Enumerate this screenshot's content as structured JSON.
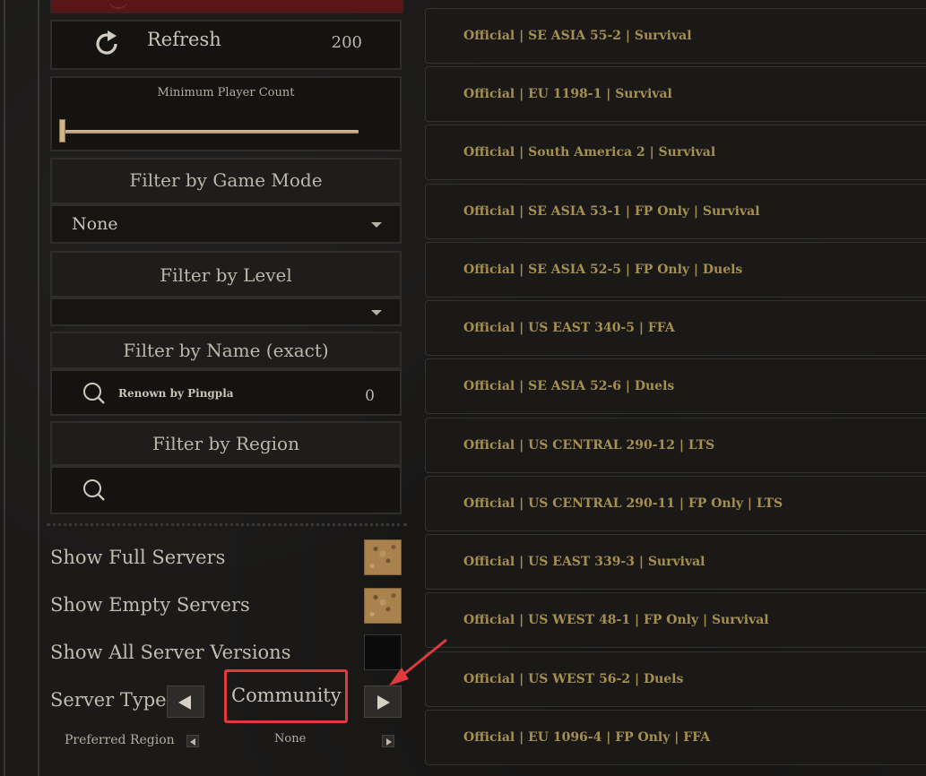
{
  "refresh": {
    "label": "Refresh",
    "count": "200"
  },
  "min_player": {
    "title": "Minimum Player Count",
    "level_fraction": 0.0
  },
  "game_mode": {
    "title": "Filter by Game Mode",
    "value": "None"
  },
  "level_filter": {
    "title": "Filter by Level",
    "value": ""
  },
  "name_filter": {
    "title": "Filter by Name (exact)",
    "value": "Renown by Pingplayer",
    "count": "0"
  },
  "region_filter": {
    "title": "Filter by Region",
    "value": ""
  },
  "options": {
    "show_full": {
      "label": "Show Full Servers",
      "checked": true
    },
    "show_empty": {
      "label": "Show Empty Servers",
      "checked": true
    },
    "show_all_versions": {
      "label": "Show All Server Versions",
      "checked": false
    }
  },
  "server_type": {
    "label": "Server Type",
    "value": "Community"
  },
  "preferred_region": {
    "label": "Preferred Region",
    "value": "None"
  },
  "servers": [
    "Official | SE ASIA 55-2 | Survival",
    "Official | EU 1198-1 | Survival",
    "Official | South America 2 | Survival",
    "Official | SE ASIA 53-1 | FP Only | Survival",
    "Official | SE ASIA 52-5 | FP Only | Duels",
    "Official | US EAST 340-5 | FFA",
    "Official | SE ASIA 52-6 | Duels",
    "Official | US CENTRAL 290-12 | LTS",
    "Official | US CENTRAL 290-11 | FP Only | LTS",
    "Official | US EAST 339-3 | Survival",
    "Official | US WEST 48-1 | FP Only | Survival",
    "Official | US WEST 56-2 | Duels",
    "Official | EU 1096-4 | FP Only | FFA"
  ],
  "colors": {
    "highlight": "#e0393e",
    "server_text": "#a58f4f",
    "checkbox_on": "#a9824d"
  },
  "icons": [
    "refresh-icon",
    "search-icon",
    "caret-down-icon",
    "arrow-left-icon",
    "arrow-right-icon"
  ]
}
